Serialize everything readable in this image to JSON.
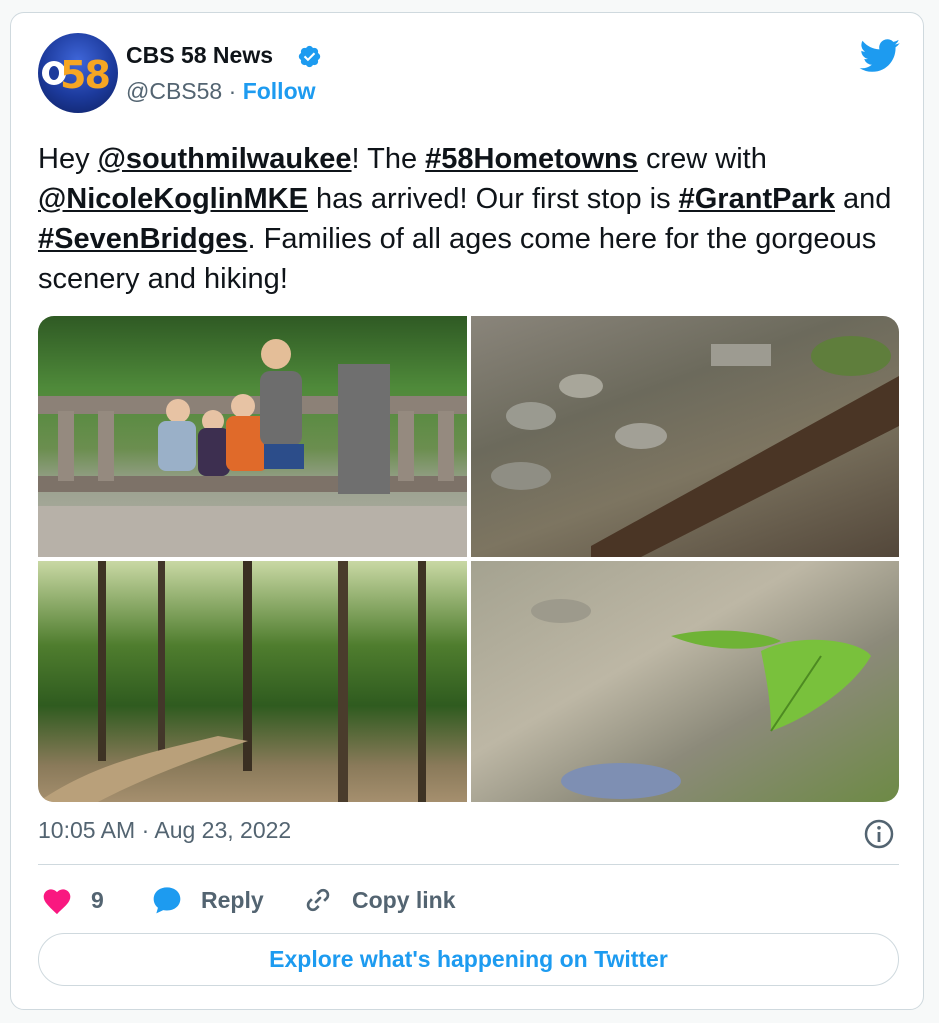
{
  "author": {
    "avatar_text": "58",
    "name": "CBS 58 News",
    "handle": "@CBS58",
    "separator": "·",
    "follow_label": "Follow"
  },
  "tweet": {
    "segments": [
      {
        "text": "Hey ",
        "mention": false
      },
      {
        "text": "@southmilwaukee",
        "mention": true
      },
      {
        "text": "! The ",
        "mention": false
      },
      {
        "text": "#58Hometowns",
        "mention": true
      },
      {
        "text": " crew with ",
        "mention": false
      },
      {
        "text": "@NicoleKoglinMKE",
        "mention": true
      },
      {
        "text": " has arrived! Our first stop is ",
        "mention": false
      },
      {
        "text": "#GrantPark",
        "mention": true
      },
      {
        "text": " and ",
        "mention": false
      },
      {
        "text": "#SevenBridges",
        "mention": true
      },
      {
        "text": ". Families of all ages come here for the gorgeous scenery and hiking!",
        "mention": false
      }
    ]
  },
  "timestamp": "10:05 AM · Aug 23, 2022",
  "actions": {
    "likes": "9",
    "reply_label": "Reply",
    "copy_link_label": "Copy link"
  },
  "explore_label": "Explore what's happening on Twitter",
  "colors": {
    "accent": "#1d9bf0",
    "like": "#f91880",
    "text": "#0f1419",
    "muted": "#536471",
    "border": "#cfd9de"
  }
}
